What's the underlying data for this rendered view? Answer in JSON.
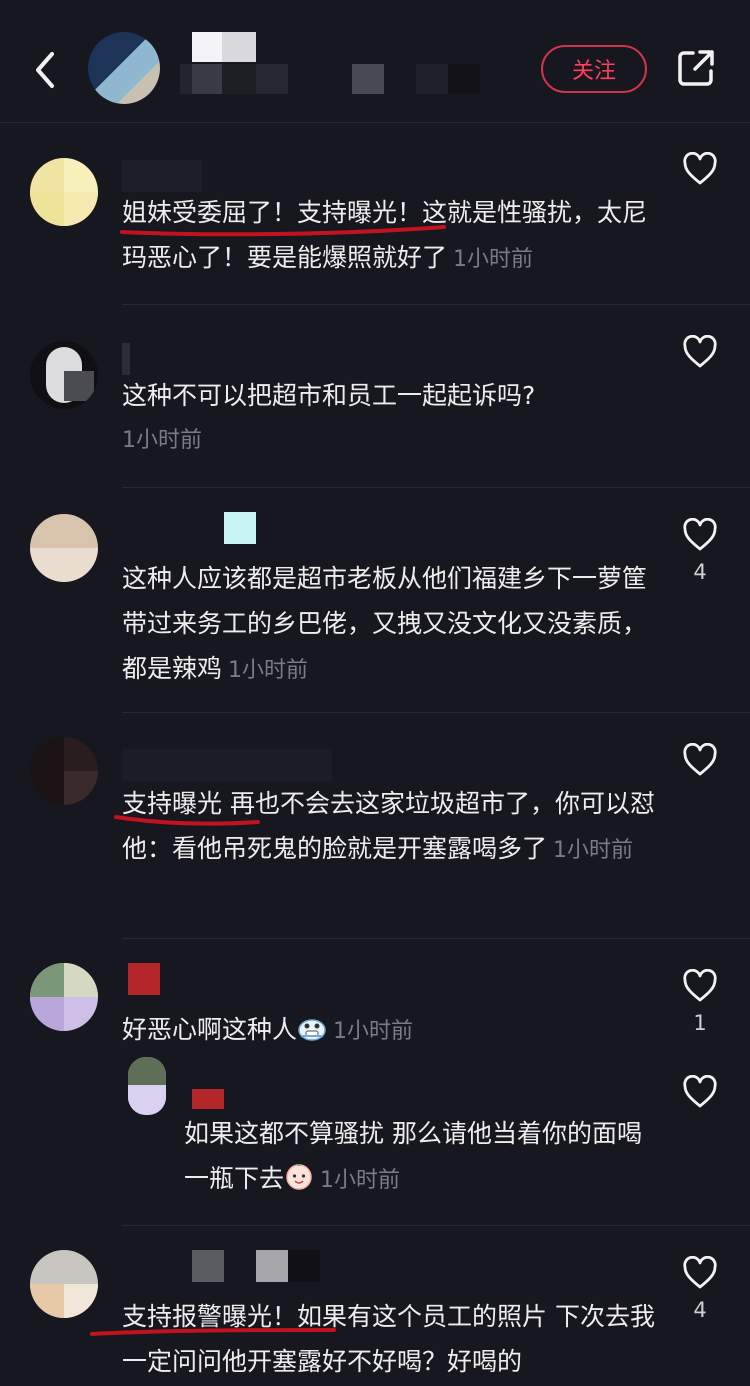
{
  "header": {
    "follow_label": "关注",
    "back_icon": "chevron-left-icon",
    "share_icon": "share-external-icon"
  },
  "comments": [
    {
      "text": "姐妹受委屈了！支持曝光！这就是性骚扰，太尼玛恶心了！要是能爆照就好了",
      "time": "1小时前",
      "likes": ""
    },
    {
      "text": "这种不可以把超市和员工一起起诉吗?",
      "time": "1小时前",
      "likes": ""
    },
    {
      "text": "这种人应该都是超市老板从他们福建乡下一萝筐带过来务工的乡巴佬，又拽又没文化又没素质，都是辣鸡",
      "time": "1小时前",
      "likes": "4"
    },
    {
      "text": "支持曝光 再也不会去这家垃圾超市了，你可以怼他：看他吊死鬼的脸就是开塞露喝多了",
      "time": "1小时前",
      "likes": ""
    },
    {
      "text": "好恶心啊这种人",
      "time": "1小时前",
      "likes": "1",
      "reply": {
        "text": "如果这都不算骚扰 那么请他当着你的面喝一瓶下去",
        "time": "1小时前",
        "likes": ""
      }
    },
    {
      "text": "支持报警曝光！如果有这个员工的照片 下次去我一定问问他开塞露好不好喝？好喝的",
      "time": "",
      "likes": "4"
    }
  ],
  "colors": {
    "background": "#17171f",
    "accent": "#ff3f5e",
    "underline": "#c1121f"
  }
}
